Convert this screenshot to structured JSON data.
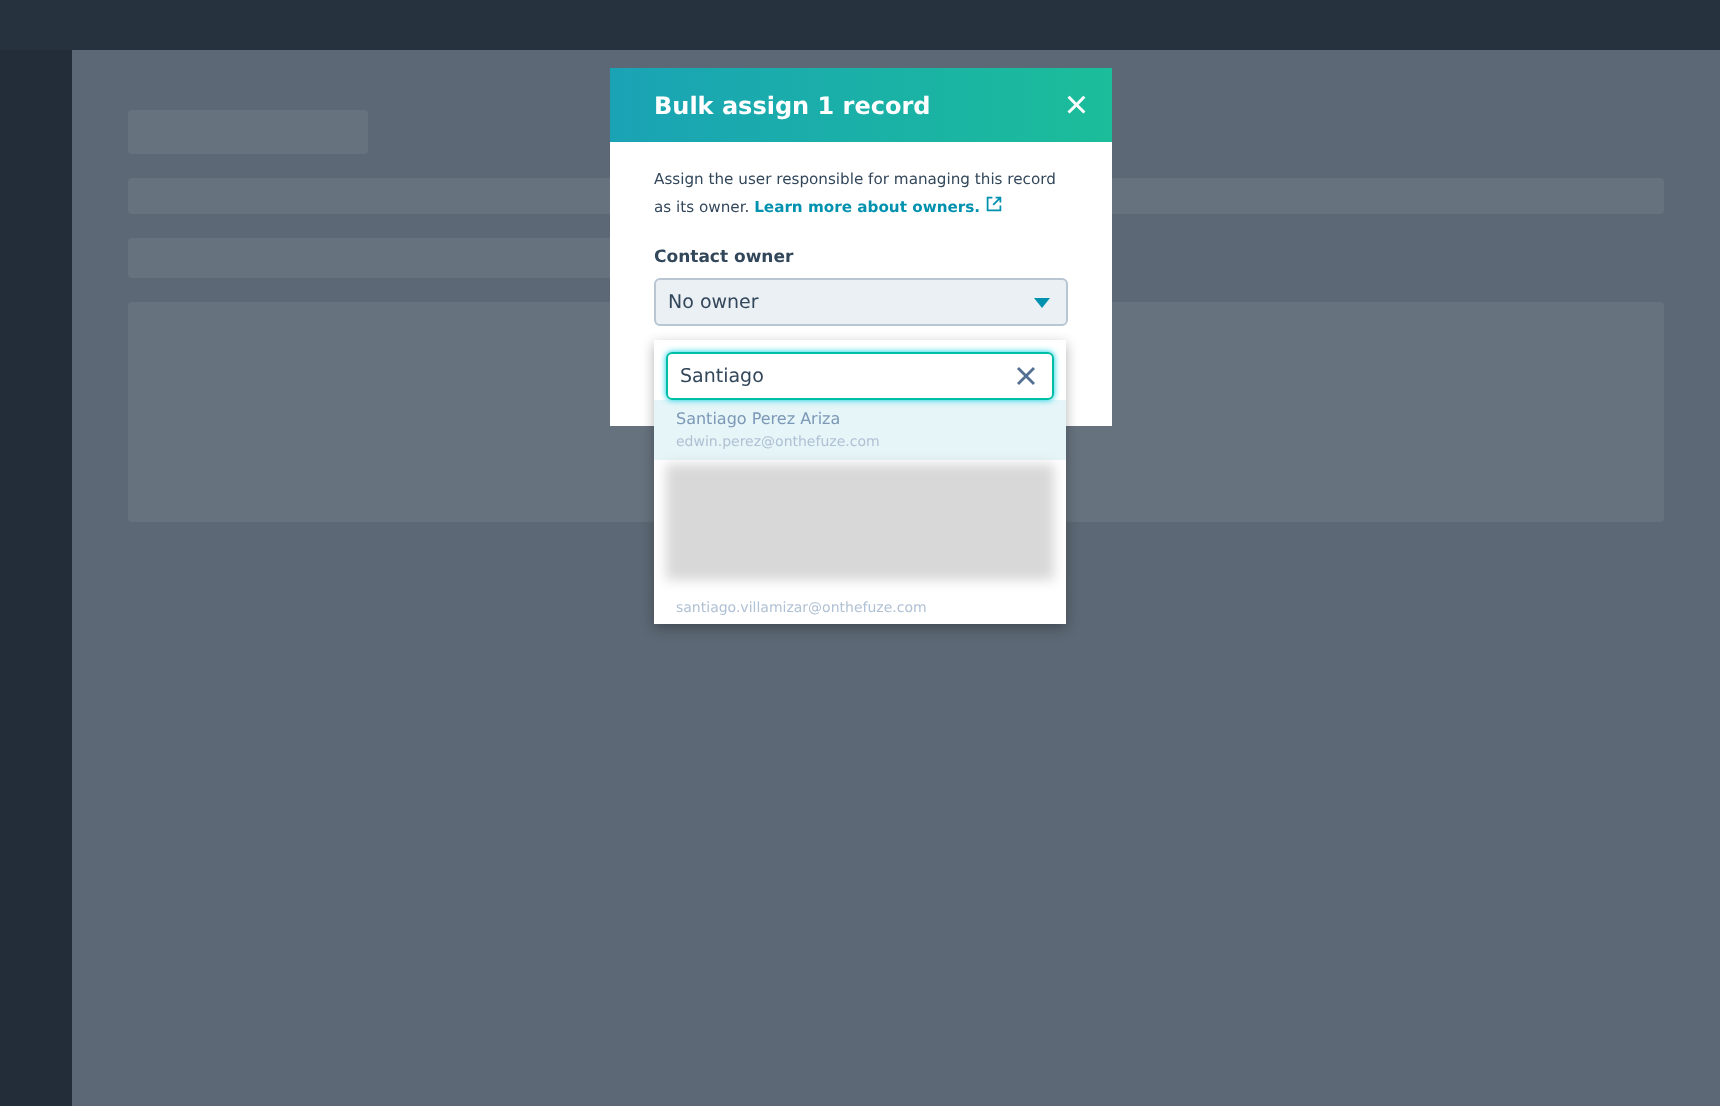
{
  "modal": {
    "title": "Bulk assign 1 record",
    "close_icon": "×",
    "description": "Assign the user responsible for managing this record as its owner.",
    "learn_more_link": "Learn more about owners.",
    "field_label": "Contact owner",
    "select": {
      "value": "No owner",
      "expanded": true
    },
    "search": {
      "value": "Santiago"
    },
    "options": [
      {
        "kind": "user",
        "name": "Santiago Perez Ariza",
        "email": "edwin.perez@onthefuze.com",
        "selected": true
      },
      {
        "kind": "blurred",
        "selected": false
      },
      {
        "kind": "email_only",
        "email": "santiago.villamizar@onthefuze.com",
        "selected": false
      }
    ]
  }
}
